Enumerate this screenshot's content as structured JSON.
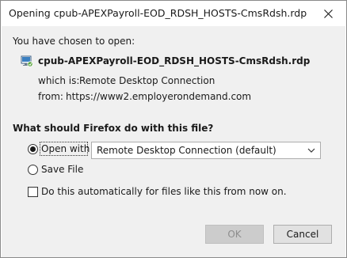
{
  "window": {
    "title": "Opening cpub-APEXPayroll-EOD_RDSH_HOSTS-CmsRdsh.rdp"
  },
  "intro": "You have chosen to open:",
  "file": {
    "name": "cpub-APEXPayroll-EOD_RDSH_HOSTS-CmsRdsh.rdp",
    "icon": "rdp-file-icon",
    "which_is_label": "which is:",
    "which_is_value": "Remote Desktop Connection",
    "from_label": "from:",
    "from_value": "https://www2.employerondemand.com"
  },
  "question": "What should Firefox do with this file?",
  "options": {
    "open_with": {
      "label": "Open with",
      "selected": true
    },
    "save_file": {
      "label": "Save File",
      "selected": false
    },
    "app_select": {
      "value": "Remote Desktop Connection (default)"
    },
    "auto": {
      "label": "Do this automatically for files like this from now on.",
      "checked": false
    }
  },
  "buttons": {
    "ok": "OK",
    "cancel": "Cancel"
  }
}
